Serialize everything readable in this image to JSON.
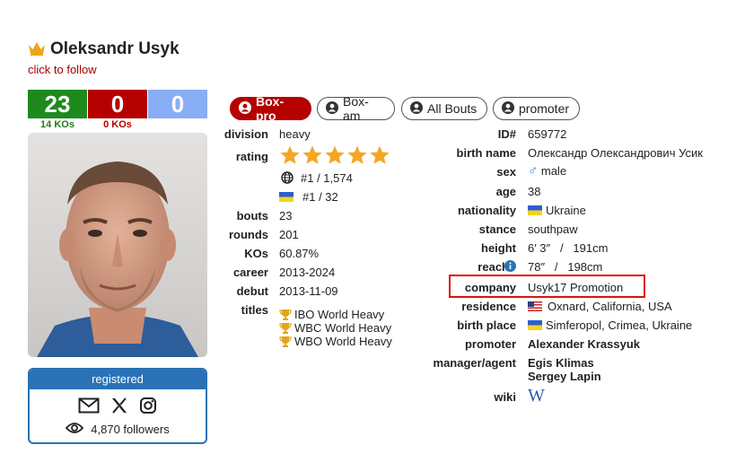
{
  "header": {
    "name": "Oleksandr Usyk",
    "follow_link": "click to follow"
  },
  "record": {
    "wins": "23",
    "losses": "0",
    "draws": "0",
    "wins_ko": "14 KOs",
    "losses_ko": "0 KOs"
  },
  "tabs": [
    {
      "label": "Box-pro"
    },
    {
      "label": "Box-am"
    },
    {
      "label": "All Bouts"
    },
    {
      "label": "promoter"
    }
  ],
  "left_info": {
    "division_label": "division",
    "division": "heavy",
    "rating_label": "rating",
    "rating_stars": 5,
    "rank_world": "#1 / 1,574",
    "rank_country": "#1 / 32",
    "bouts_label": "bouts",
    "bouts": "23",
    "rounds_label": "rounds",
    "rounds": "201",
    "kos_label": "KOs",
    "kos": "60.87%",
    "career_label": "career",
    "career": "2013-2024",
    "debut_label": "debut",
    "debut": "2013-11-09",
    "titles_label": "titles",
    "titles": [
      "IBO World Heavy",
      "WBC World Heavy",
      "WBO World Heavy"
    ]
  },
  "right_info": {
    "id_label": "ID#",
    "id": "659772",
    "birth_name_label": "birth name",
    "birth_name": "Олександр Олександрович Усик",
    "sex_label": "sex",
    "sex": "male",
    "age_label": "age",
    "age": "38",
    "nationality_label": "nationality",
    "nationality": "Ukraine",
    "stance_label": "stance",
    "stance": "southpaw",
    "height_label": "height",
    "height": "6′ 3″   /   191cm",
    "reach_label": "reach",
    "reach": "78″   /   198cm",
    "company_label": "company",
    "company": "Usyk17 Promotion",
    "residence_label": "residence",
    "residence": "Oxnard, California, USA",
    "birth_place_label": "birth place",
    "birth_place": "Simferopol, Crimea, Ukraine",
    "promoter_label": "promoter",
    "promoter": "Alexander Krassyuk",
    "manager_label": "manager/agent",
    "managers": [
      "Egis Klimas",
      "Sergey Lapin"
    ],
    "wiki_label": "wiki",
    "wiki_glyph": "W"
  },
  "registered": {
    "label": "registered",
    "followers": "4,870 followers"
  },
  "colors": {
    "win": "#1e8a1e",
    "loss": "#b50000",
    "draw": "#88aef5",
    "accent_blue": "#2a72b5",
    "star": "#f5a623",
    "highlight": "#e01010"
  }
}
